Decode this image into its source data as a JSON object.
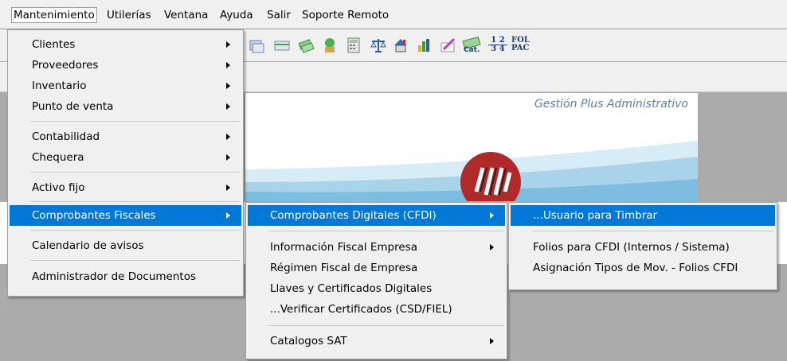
{
  "menubar": {
    "items": [
      {
        "label": "Mantenimiento"
      },
      {
        "label": "Utilerías"
      },
      {
        "label": "Ventana"
      },
      {
        "label": "Ayuda"
      },
      {
        "label": "Salir"
      },
      {
        "label": "Soporte Remoto"
      }
    ]
  },
  "toolbar": {
    "icons": [
      "folders-icon",
      "card-icon",
      "money-icon",
      "plant-icon",
      "calculator-icon",
      "scales-icon",
      "house-icon",
      "bar-chart-icon",
      "pen-icon",
      "catalog-icon",
      "fractions-icon",
      "folios-pac-icon"
    ],
    "catalog_label": "Cat.",
    "fraction_top": "1 2",
    "fraction_bottom": "3 4",
    "fol_label": "FOL",
    "pac_label": "PAC"
  },
  "banner": {
    "subtitle": "Gestión Plus Administrativo"
  },
  "menu_main": {
    "items": [
      {
        "label": "Clientes"
      },
      {
        "label": "Proveedores"
      },
      {
        "label": "Inventario"
      },
      {
        "label": "Punto de venta"
      },
      {
        "label": "Contabilidad"
      },
      {
        "label": "Chequera"
      },
      {
        "label": "Activo fijo"
      },
      {
        "label": "Comprobantes Fiscales"
      },
      {
        "label": "Calendario de avisos"
      },
      {
        "label": "Administrador de Documentos"
      }
    ]
  },
  "menu_fiscal": {
    "items": [
      {
        "label": "Comprobantes Digitales (CFDI)"
      },
      {
        "label": "Información Fiscal Empresa"
      },
      {
        "label": "Régimen Fiscal de Empresa"
      },
      {
        "label": "Llaves y Certificados Digitales"
      },
      {
        "label": "...Verificar Certificados (CSD/FIEL)"
      },
      {
        "label": "Catalogos SAT"
      }
    ]
  },
  "menu_cfdi": {
    "items": [
      {
        "label": "...Usuario para Timbrar"
      },
      {
        "label": "Folios para CFDI (Internos / Sistema)"
      },
      {
        "label": "Asignación Tipos de Mov. - Folios CFDI"
      }
    ]
  },
  "colors": {
    "highlight": "#0078d7",
    "menu_bg": "#f0f0f0",
    "desktop": "#ababab",
    "subtitle": "#5b7fa8"
  }
}
